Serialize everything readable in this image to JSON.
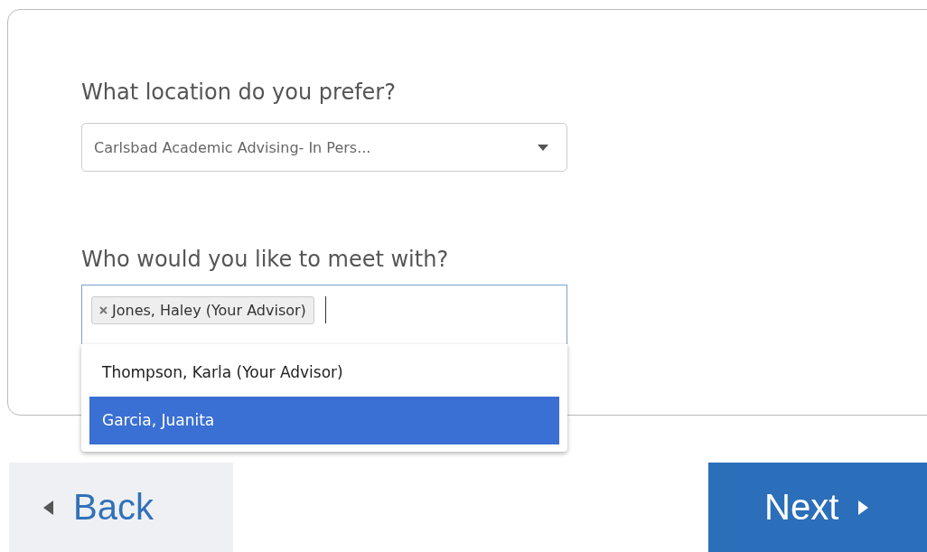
{
  "location": {
    "label": "What location do you prefer?",
    "value": "Carlsbad Academic Advising- In Pers..."
  },
  "advisor": {
    "label": "Who would you like to meet with?",
    "tags": [
      "Jones, Haley (Your Advisor)"
    ],
    "options": [
      {
        "label": "Thompson, Karla (Your Advisor)",
        "selected": false
      },
      {
        "label": "Garcia, Juanita",
        "selected": true
      }
    ]
  },
  "buttons": {
    "back": "Back",
    "next": "Next"
  }
}
